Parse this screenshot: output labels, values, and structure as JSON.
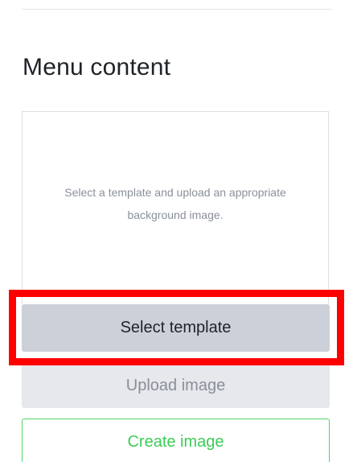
{
  "section": {
    "title": "Menu content"
  },
  "preview": {
    "text_line1": "Select a template and upload an appropriate",
    "text_line2": "background image."
  },
  "buttons": {
    "select_template": "Select template",
    "upload_image": "Upload image",
    "create_image": "Create image"
  },
  "colors": {
    "highlight": "#ff0000",
    "select_bg": "#ccd0d9",
    "upload_bg": "#e6e8ec",
    "create_border": "#4cd964",
    "create_text": "#3dcc59"
  }
}
